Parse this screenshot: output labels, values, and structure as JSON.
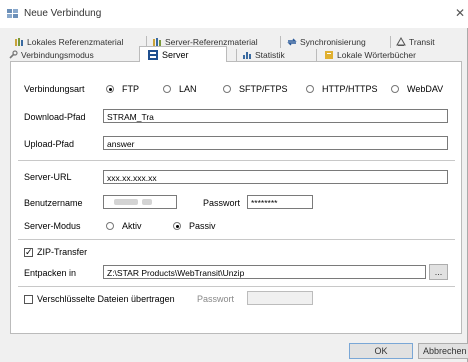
{
  "window": {
    "title": "Neue Verbindung",
    "close_glyph": "✕"
  },
  "tabs_row1": [
    {
      "label": "Lokales Referenzmaterial",
      "icon": "books-icon"
    },
    {
      "label": "Server-Referenzmaterial",
      "icon": "server-books-icon"
    },
    {
      "label": "Synchronisierung",
      "icon": "sync-icon"
    },
    {
      "label": "Transit",
      "icon": "transit-icon"
    }
  ],
  "tabs_row2": [
    {
      "label": "Verbindungsmodus",
      "icon": "wrench-icon"
    },
    {
      "label": "Server",
      "icon": "server-icon",
      "active": true
    },
    {
      "label": "Statistik",
      "icon": "chart-icon"
    },
    {
      "label": "Lokale Wörterbücher",
      "icon": "dictionary-icon"
    }
  ],
  "form": {
    "connection_type_label": "Verbindungsart",
    "connection_types": [
      "FTP",
      "LAN",
      "SFTP/FTPS",
      "HTTP/HTTPS",
      "WebDAV"
    ],
    "connection_type_selected": "FTP",
    "download_path_label": "Download-Pfad",
    "download_path_value": "STRAM_Tra",
    "upload_path_label": "Upload-Pfad",
    "upload_path_value": "answer",
    "server_url_label": "Server-URL",
    "server_url_value": "xxx.xx.xxx.xx",
    "username_label": "Benutzername",
    "password_label": "Passwort",
    "password_value": "********",
    "server_mode_label": "Server-Modus",
    "server_modes": [
      "Aktiv",
      "Passiv"
    ],
    "server_mode_selected": "Passiv",
    "zip_label": "ZIP-Transfer",
    "zip_checked": true,
    "unpack_label": "Entpacken in",
    "unpack_value": "Z:\\STAR Products\\WebTransit\\Unzip",
    "browse_label": "...",
    "encrypted_label": "Verschlüsselte Dateien übertragen",
    "encrypted_checked": false,
    "encrypted_password_label": "Passwort",
    "encrypted_password_value": ""
  },
  "buttons": {
    "ok": "OK",
    "cancel": "Abbrechen"
  },
  "colors": {
    "accent": "#1f6fbf",
    "panel_border": "#bbbbbb",
    "field_border": "#7a7a7a"
  }
}
